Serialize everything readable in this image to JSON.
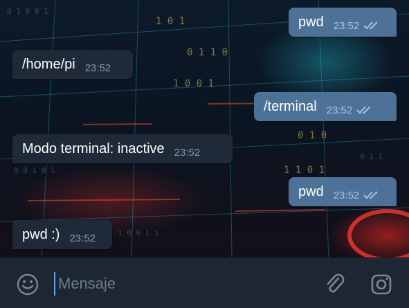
{
  "messages": [
    {
      "direction": "out",
      "text": "pwd",
      "time": "23:52",
      "status": "read"
    },
    {
      "direction": "in",
      "text": "/home/pi",
      "time": "23:52"
    },
    {
      "direction": "out",
      "text": "/terminal",
      "time": "23:52",
      "status": "read"
    },
    {
      "direction": "in",
      "text": "Modo terminal: inactive",
      "time": "23:52"
    },
    {
      "direction": "out",
      "text": "pwd",
      "time": "23:52",
      "status": "read"
    },
    {
      "direction": "in",
      "text": "pwd :)",
      "time": "23:52"
    }
  ],
  "input": {
    "placeholder": "Mensaje",
    "value": ""
  },
  "icons": {
    "emoji": "smiley-icon",
    "attach": "paperclip-icon",
    "camera": "camera-icon",
    "read_receipt": "double-check-icon"
  },
  "colors": {
    "outgoing_bubble": "#4e7297",
    "incoming_bubble": "#1f2a38",
    "input_bar": "#1d2733",
    "caret": "#5fa7e8"
  }
}
